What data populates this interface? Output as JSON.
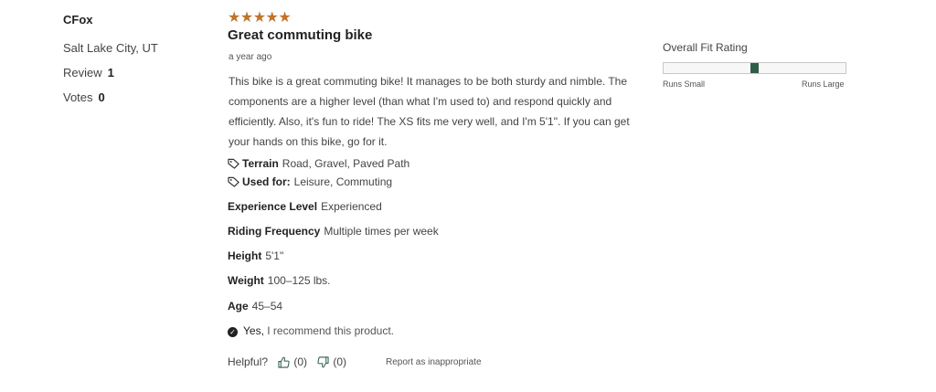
{
  "reviewer": {
    "name": "CFox",
    "location": "Salt Lake City, UT",
    "review_label": "Review",
    "review_count": "1",
    "votes_label": "Votes",
    "votes_count": "0"
  },
  "review": {
    "stars": "★★★★★",
    "rating": 5,
    "title": "Great commuting bike",
    "date": "a year ago",
    "body": "This bike is a great commuting bike! It manages to be both sturdy and nimble. The components are a higher level (than what I'm used to) and respond quickly and efficiently. Also, it's fun to ride! The XS fits me very well, and I'm 5'1\". If you can get your hands on this bike, go for it.",
    "terrain_label": "Terrain",
    "terrain_value": "Road, Gravel, Paved Path",
    "used_for_label": "Used for:",
    "used_for_value": "Leisure, Commuting",
    "experience_label": "Experience Level",
    "experience_value": "Experienced",
    "frequency_label": "Riding Frequency",
    "frequency_value": "Multiple times per week",
    "height_label": "Height",
    "height_value": "5'1\"",
    "weight_label": "Weight",
    "weight_value": "100–125 lbs.",
    "age_label": "Age",
    "age_value": "45–54",
    "recommend_yes": "Yes,",
    "recommend_text": "I recommend this product.",
    "helpful_label": "Helpful?",
    "helpful_up_count": "(0)",
    "helpful_down_count": "(0)",
    "report_label": "Report as inappropriate"
  },
  "fit": {
    "title": "Overall Fit Rating",
    "low_label": "Runs Small",
    "high_label": "Runs Large",
    "value_fraction": 0.5,
    "marker_color": "#2e5e47"
  },
  "colors": {
    "star": "#c0742b",
    "text": "#444444"
  }
}
